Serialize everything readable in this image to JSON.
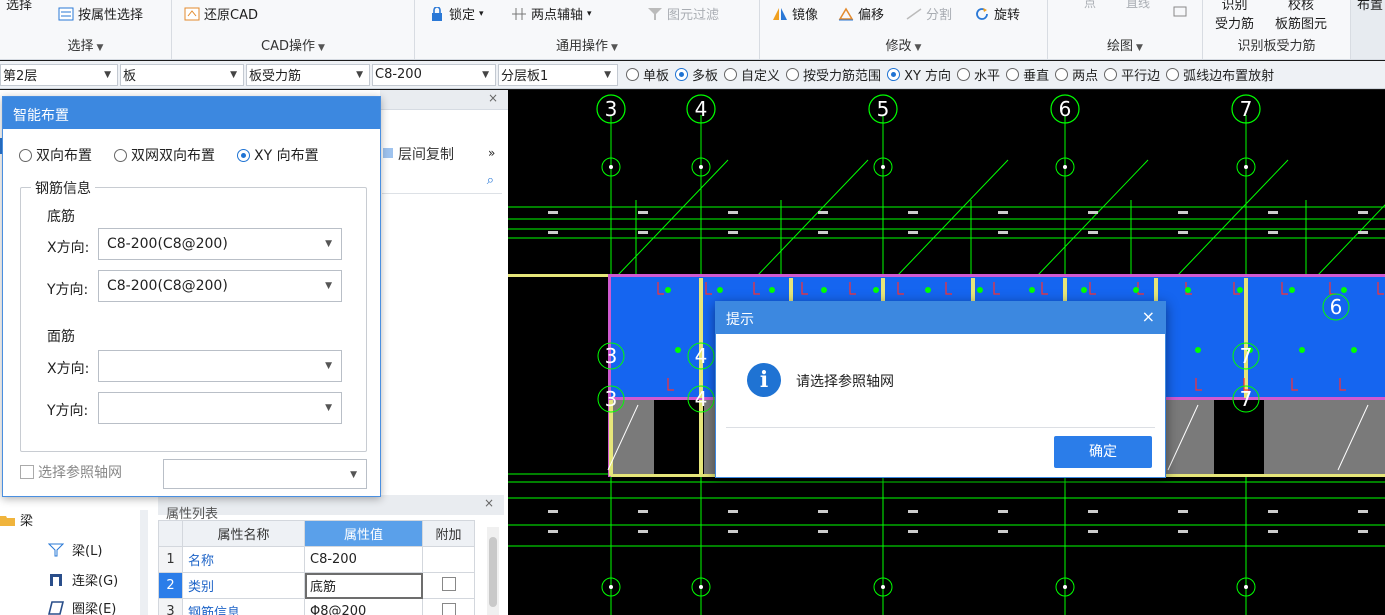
{
  "ribbon": {
    "select_group": {
      "item0": "选择",
      "by_attr": "按属性选择",
      "caption": "选择"
    },
    "cad_group": {
      "restore_cad": "还原CAD",
      "caption": "CAD操作"
    },
    "general_group": {
      "lock": "锁定",
      "two_point_axis": "两点辅轴",
      "element_filter": "图元过滤",
      "caption": "通用操作"
    },
    "modify_group": {
      "mirror": "镜像",
      "offset": "偏移",
      "split": "分割",
      "rotate": "旋转",
      "caption": "修改"
    },
    "draw_group": {
      "point": "点",
      "line": "直线",
      "caption": "绘图"
    },
    "recognize_group": {
      "btn1_top": "识别",
      "btn1_bottom": "受力筋",
      "btn2_top": "校核",
      "btn2_bottom": "板筋图元",
      "caption": "识别板受力筋"
    },
    "layout_group": {
      "label": "布置"
    }
  },
  "propbar": {
    "floor": "第2层",
    "type": "板",
    "rebar_type": "板受力筋",
    "spec": "C8-200",
    "layer": "分层板1",
    "options": [
      {
        "label": "单板",
        "checked": false
      },
      {
        "label": "多板",
        "checked": true
      },
      {
        "label": "自定义",
        "checked": false
      },
      {
        "label": "按受力筋范围",
        "checked": false
      },
      {
        "label": "XY 方向",
        "checked": true
      },
      {
        "label": "水平",
        "checked": false
      },
      {
        "label": "垂直",
        "checked": false
      },
      {
        "label": "两点",
        "checked": false
      },
      {
        "label": "平行边",
        "checked": false
      },
      {
        "label": "弧线边布置放射",
        "checked": false
      }
    ]
  },
  "left_panel": {
    "toolbar": {
      "layer_copy": "层间复制",
      "more": "»"
    },
    "tree": {
      "category": "梁",
      "items": [
        "梁(L)",
        "连梁(G)",
        "圈梁(E)"
      ]
    },
    "prop_list": {
      "title": "属性列表",
      "headers": {
        "num": "",
        "name": "属性名称",
        "value": "属性值",
        "extra": "附加"
      },
      "rows": [
        {
          "num": "1",
          "name": "名称",
          "value": "C8-200"
        },
        {
          "num": "2",
          "name": "类别",
          "value": "底筋"
        },
        {
          "num": "3",
          "name": "钢筋信息",
          "value": "Φ8@200"
        }
      ]
    }
  },
  "smart_dialog": {
    "title": "智能布置",
    "options": [
      {
        "label": "双向布置",
        "checked": false
      },
      {
        "label": "双网双向布置",
        "checked": false
      },
      {
        "label": "XY 向布置",
        "checked": true
      }
    ],
    "group_title": "钢筋信息",
    "bottom_section": "底筋",
    "top_section": "面筋",
    "x_label": "X方向:",
    "y_label": "Y方向:",
    "bottom_x": "C8-200(C8@200)",
    "bottom_y": "C8-200(C8@200)",
    "top_x": "",
    "top_y": "",
    "select_axis_label": "选择参照轴网",
    "select_axis_value": ""
  },
  "cad": {
    "top_axes": [
      "3",
      "4",
      "5",
      "6",
      "7"
    ],
    "row_axes": [
      "3",
      "4",
      "5",
      "6",
      "7"
    ],
    "side_labels": [
      "3",
      "4",
      "3",
      "4",
      "7",
      "7",
      "6"
    ]
  },
  "tip_dialog": {
    "title": "提示",
    "message": "请选择参照轴网",
    "ok": "确定",
    "close": "×"
  },
  "colors": {
    "accent": "#3c88e0",
    "slab": "#1565f0",
    "grid_green": "#00ff00",
    "beam_magenta": "#d05ad0",
    "beam_yellow": "#e6e67a"
  }
}
